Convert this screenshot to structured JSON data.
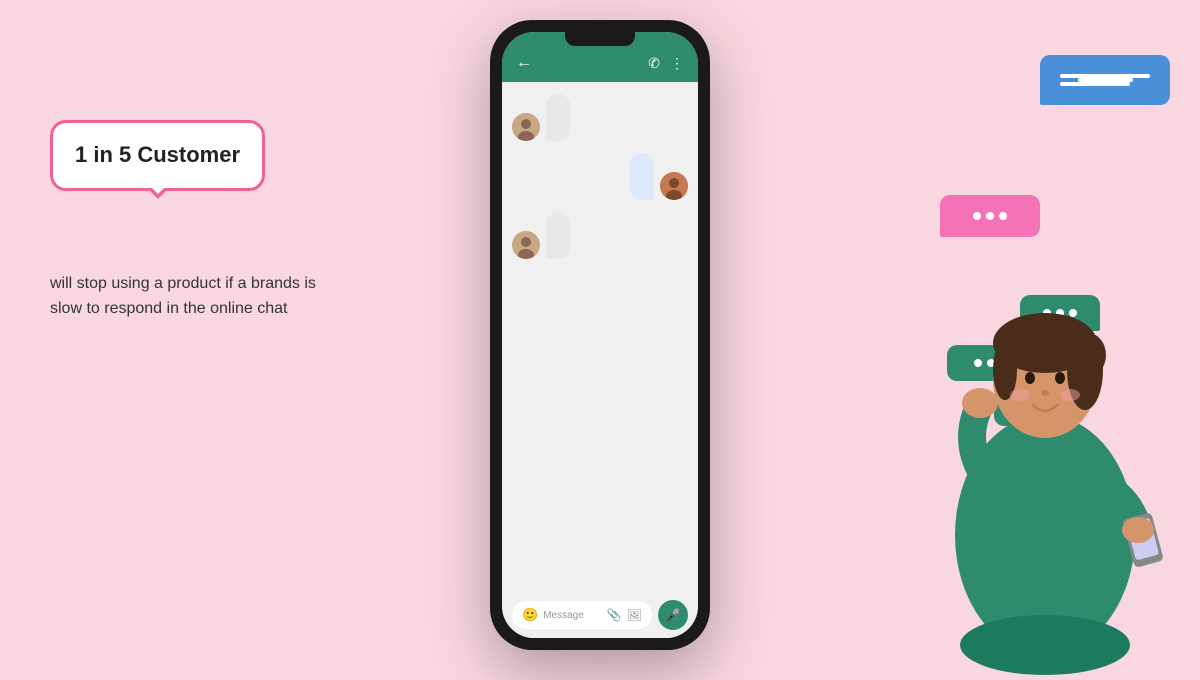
{
  "background_color": "#f9d7e0",
  "left": {
    "bubble_line1": "1 in 5 Customer",
    "bubble_text": "1 in 5 Customer",
    "description": "will stop using a product if a brands  is slow to respond in the online chat"
  },
  "phone": {
    "message_placeholder": "Message",
    "header_color": "#2e8b6e"
  },
  "deco_bubbles": {
    "blue_label": "blue speech bubble",
    "pink_label": "pink typing bubble",
    "teal_labels": [
      "teal bubble 1",
      "teal bubble 2",
      "teal bubble 3"
    ]
  }
}
